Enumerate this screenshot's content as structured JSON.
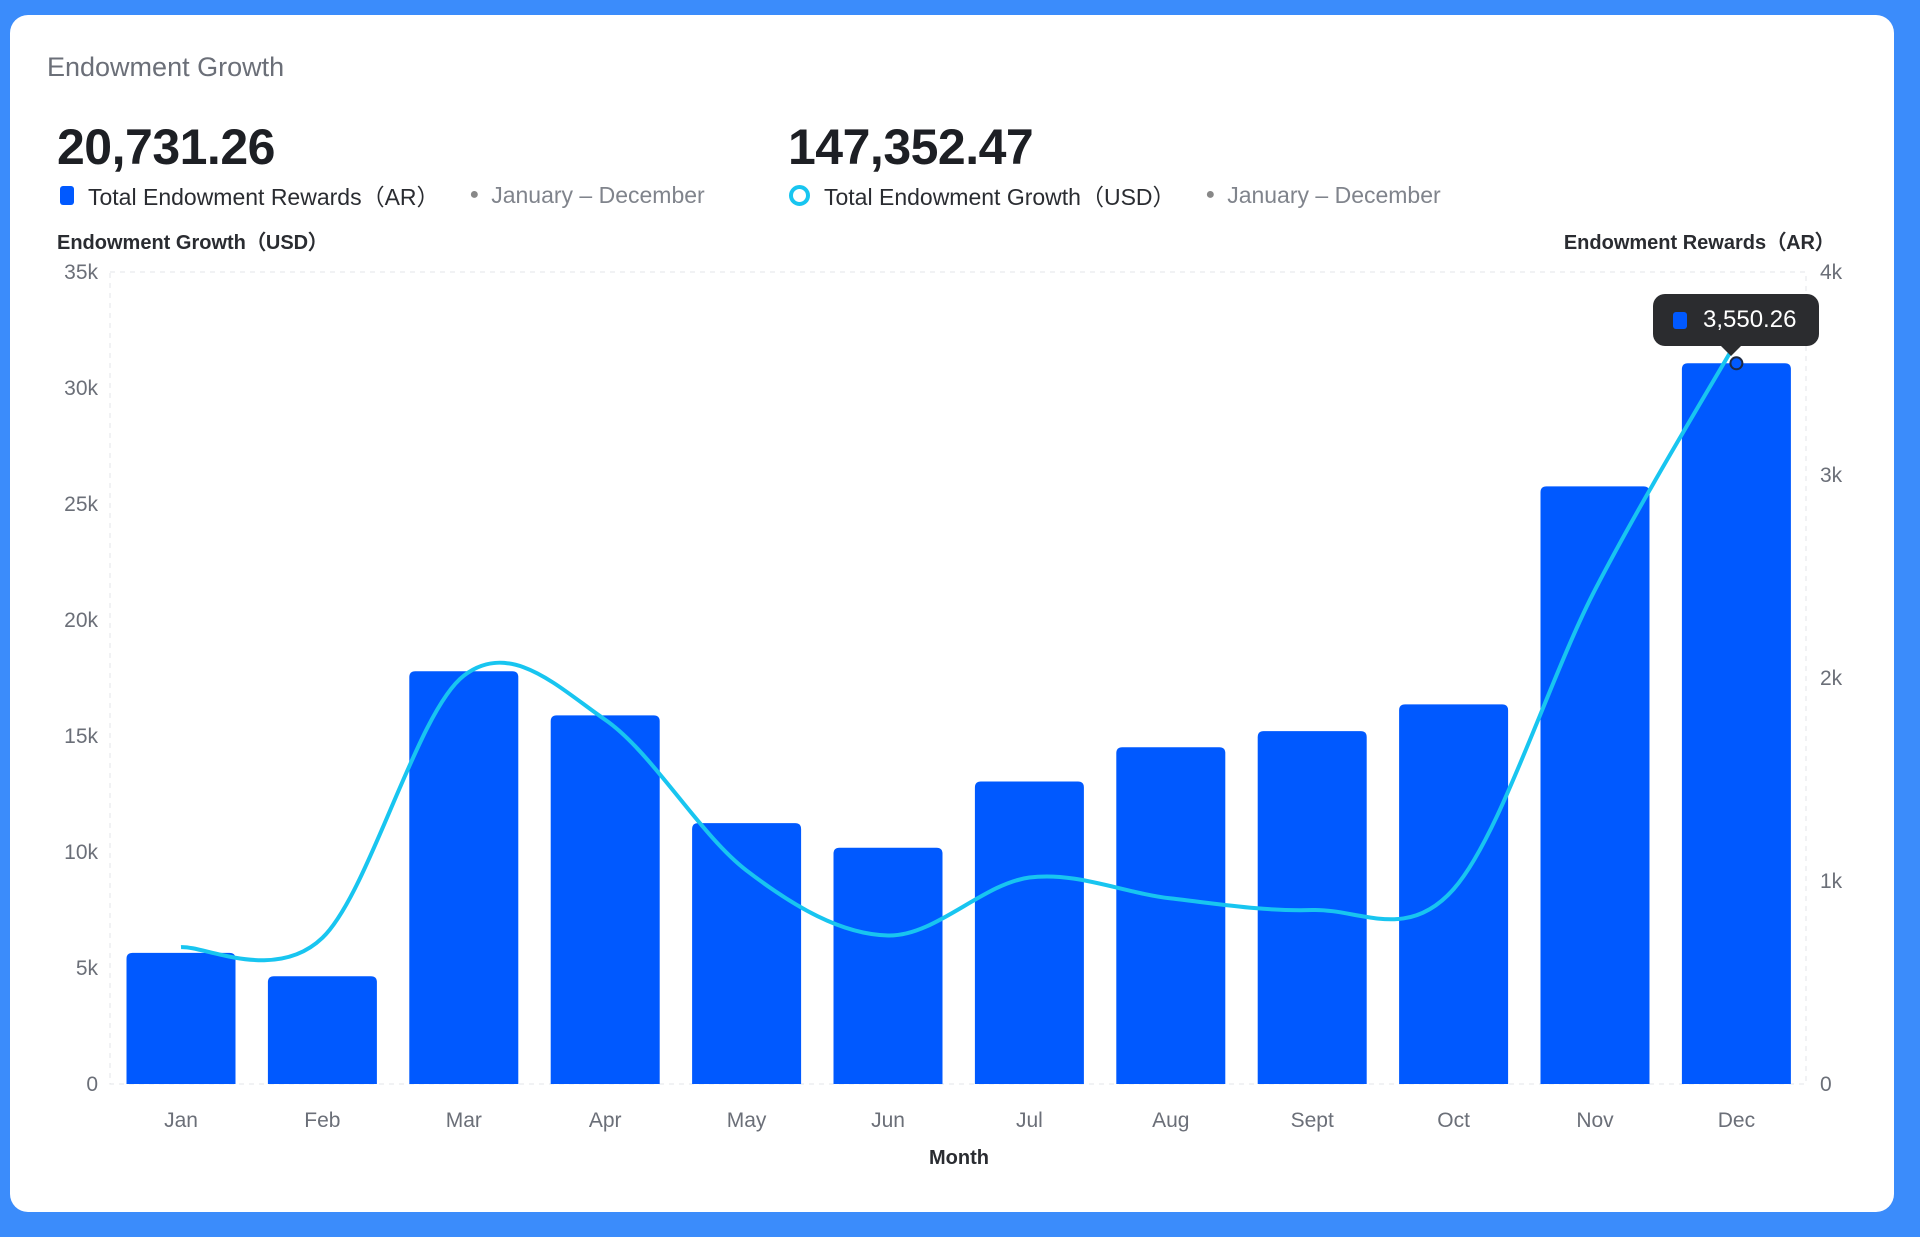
{
  "card": {
    "title": "Endowment Growth"
  },
  "summary": [
    {
      "value": "20,731.26",
      "label": "Total Endowment Rewards（AR）",
      "range": "January – December"
    },
    {
      "value": "147,352.47",
      "label": "Total Endowment Growth（USD）",
      "range": "January – December"
    }
  ],
  "chart_data": {
    "type": "bar+line",
    "title": "Endowment Growth",
    "xlabel": "Month",
    "ylabel_left": "Endowment Growth（USD）",
    "ylabel_right": "Endowment Rewards（AR）",
    "categories": [
      "Jan",
      "Feb",
      "Mar",
      "Apr",
      "May",
      "Jun",
      "Jul",
      "Aug",
      "Sept",
      "Oct",
      "Nov",
      "Dec"
    ],
    "left_ticks": [
      "0",
      "5k",
      "10k",
      "15k",
      "20k",
      "25k",
      "30k",
      "35k"
    ],
    "right_ticks": [
      "0",
      "1k",
      "2k",
      "3k",
      "4k"
    ],
    "ylim_left": [
      0,
      35000
    ],
    "ylim_right": [
      0,
      4000
    ],
    "series": [
      {
        "name": "Total Endowment Rewards（AR）",
        "type": "bar",
        "axis": "right",
        "color": "#0059ff",
        "values": [
          646,
          531,
          2033,
          1816,
          1285,
          1164,
          1490,
          1659,
          1738,
          1870,
          2944,
          3550.26
        ]
      },
      {
        "name": "Total Endowment Growth（USD）",
        "type": "line",
        "axis": "left",
        "color": "#18c5f0",
        "values": [
          5900,
          6300,
          17600,
          15700,
          9200,
          6400,
          8900,
          8000,
          7500,
          8400,
          21300,
          32000
        ]
      }
    ],
    "tooltip": {
      "category": "Dec",
      "value": "3,550.26"
    },
    "grid": "dashed border only",
    "legend": "top-left"
  }
}
